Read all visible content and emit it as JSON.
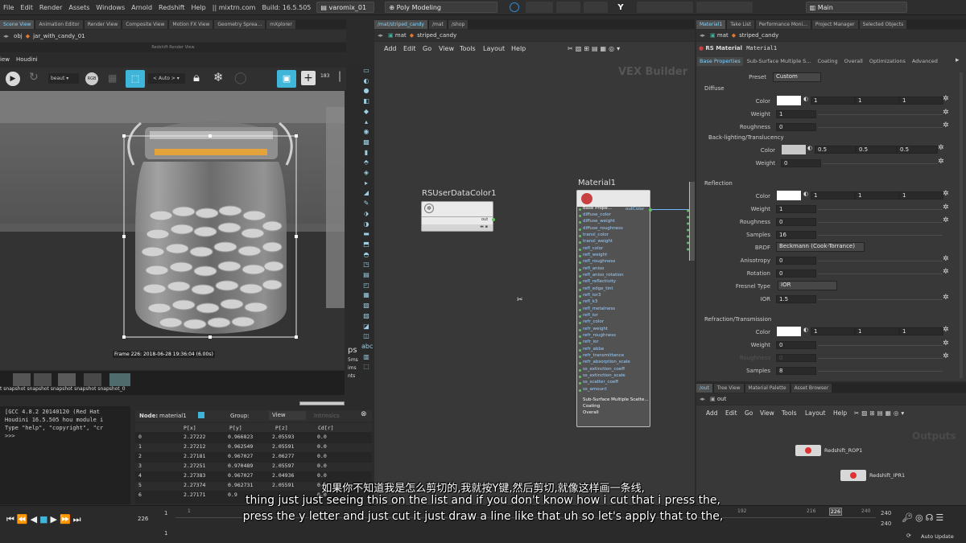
{
  "menubar": {
    "items": [
      "File",
      "Edit",
      "Render",
      "Assets",
      "Windows",
      "Arnold",
      "Redshift",
      "Help"
    ],
    "site": "mixtrn.com",
    "build": "Build: 16.5.505",
    "scene": "varomix_01",
    "desktop": "Poly Modeling",
    "key_hint": "Y",
    "main_desktop": "Main"
  },
  "left_panel": {
    "tabs": [
      "Scene View",
      "Animation Editor",
      "Render View",
      "Composite View",
      "Motion FX View",
      "Geometry Sprea...",
      "mXplorer"
    ],
    "path": "obj",
    "node": "jar_with_candy_01",
    "window_title": "Redshift Render View",
    "menus": [
      "iew",
      "Houdini"
    ],
    "aov": "beaut",
    "rgb": "RGB",
    "auto": "< Auto >",
    "zoom": "183",
    "frame_info": "Frame 226: 2018-06-28 19:36:04 (6.00s)",
    "snapshot_label": "t snapshot snapshot snapshot snapshot snapshot_0",
    "side_text": [
      "ps",
      "5ms",
      "ims",
      "nts"
    ]
  },
  "console": {
    "lines": [
      "[GCC 4.8.2 20140120 (Red Hat",
      "Houdini 16.5.505 hou module i",
      "Type \"help\", \"copyright\", \"cr",
      ">>>"
    ]
  },
  "spreadsheet": {
    "node_label": "Node:",
    "node": "material1",
    "group_label": "Group:",
    "view": "View",
    "mode": "Intrinsics",
    "headers": [
      "",
      "P[x]",
      "P[y]",
      "P[z]",
      "Cd[r]"
    ],
    "rows": [
      [
        "0",
        "2.27222",
        "0.966823",
        "2.05593",
        "0.0"
      ],
      [
        "1",
        "2.27212",
        "0.962549",
        "2.05591",
        "0.0"
      ],
      [
        "2",
        "2.27181",
        "0.967027",
        "2.06277",
        "0.0"
      ],
      [
        "3",
        "2.27251",
        "0.970489",
        "2.05597",
        "0.0"
      ],
      [
        "4",
        "2.27383",
        "0.967027",
        "2.04936",
        "0.0"
      ],
      [
        "5",
        "2.27374",
        "0.962731",
        "2.05591",
        "0.0"
      ],
      [
        "6",
        "2.27171",
        "0.9",
        "",
        "0.0"
      ]
    ]
  },
  "vex": {
    "tabs": [
      "/mat/striped_candy",
      "/mat",
      "/shop"
    ],
    "path_root": "mat",
    "path_node": "striped_candy",
    "menus": [
      "Add",
      "Edit",
      "Go",
      "View",
      "Tools",
      "Layout",
      "Help"
    ],
    "watermark": "VEX Builder",
    "node1_title": "RSUserDataColor1",
    "node1_out": "out",
    "node2_title": "Material1",
    "node2_out": "outColor",
    "ports": [
      "Base Prope...",
      "diffuse_color",
      "diffuse_weight",
      "diffuse_roughness",
      "transl_color",
      "transl_weight",
      "refl_color",
      "refl_weight",
      "refl_roughness",
      "refl_aniso",
      "refl_aniso_rotation",
      "refl_reflectivity",
      "refl_edge_tint",
      "refl_ior3",
      "refl_k3",
      "refl_metalness",
      "refl_ior",
      "refr_color",
      "refr_weight",
      "refr_roughness",
      "refr_ior",
      "refr_abbe",
      "refr_transmittance",
      "refr_absorption_scale",
      "ss_extinction_coeff",
      "ss_extinction_scale",
      "ss_scatter_coeff",
      "ss_amount"
    ],
    "footer": [
      "Sub-Surface Multiple Scatte...",
      "Coating",
      "Overall"
    ]
  },
  "params": {
    "tabs": [
      "Material1",
      "Take List",
      "Performance Moni...",
      "Project Manager",
      "Selected Objects"
    ],
    "path_root": "mat",
    "path_node": "striped_candy",
    "type_label": "RS Material",
    "name": "Material1",
    "subtabs": [
      "Base Properties",
      "Sub-Surface Multiple S...",
      "Coating",
      "Overall",
      "Optimizations",
      "Advanced"
    ],
    "preset_label": "Preset",
    "preset": "Custom",
    "diffuse": "Diffuse",
    "color": "Color",
    "weight": "Weight",
    "roughness": "Roughness",
    "backlight": "Back-lighting/Translucency",
    "reflection": "Reflection",
    "samples": "Samples",
    "brdf_label": "BRDF",
    "brdf": "Beckmann (Cook-Torrance)",
    "anisotropy": "Anisotropy",
    "rotation": "Rotation",
    "fresnel_label": "Fresnel Type",
    "fresnel": "IOR",
    "ior_label": "IOR",
    "refraction": "Refraction/Transmission",
    "v_one": "1",
    "v_zero": "0",
    "v_half": "0.5",
    "v_16": "16",
    "v_15": "1.5",
    "v_8": "8"
  },
  "out_net": {
    "tabs": [
      "/out",
      "Tree View",
      "Material Palette",
      "Asset Browser"
    ],
    "path": "out",
    "menus": [
      "Add",
      "Edit",
      "Go",
      "View",
      "Tools",
      "Layout",
      "Help"
    ],
    "watermark": "Outputs",
    "rop1": "Redshift_ROP1",
    "rop2": "Redshift_IPR1"
  },
  "timeline": {
    "current_frame": "226",
    "start": "1",
    "ticks": [
      "1",
      "192",
      "216",
      "226",
      "240"
    ],
    "end": "240",
    "end2": "240",
    "auto_update": "Auto Update"
  },
  "subtitles": {
    "zh": "如果你不知道我是怎么剪切的,我就按Y键,然后剪切,就像这样画一条线,",
    "en1": "thing just just seeing this on the list and if you don't know how i cut that i press the,",
    "en2": "press the y letter and just cut it just draw a line like that uh so let's apply that to the,"
  },
  "colors": {
    "accent": "#7fd3ff",
    "node_title": "#d04040",
    "port": "#5ec35e",
    "select_cyan": "#3fb5d9"
  }
}
